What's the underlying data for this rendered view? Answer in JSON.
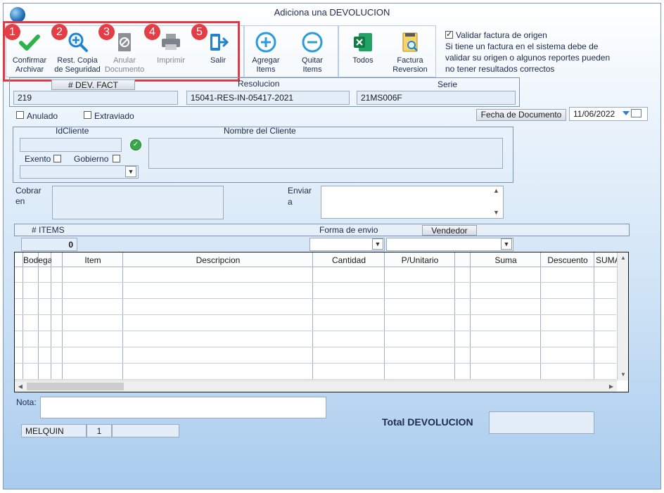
{
  "window": {
    "title": "Adiciona una DEVOLUCION"
  },
  "toolbar": {
    "confirm": {
      "badge": "1",
      "line1": "Confirmar",
      "line2": "Archivar"
    },
    "backup": {
      "badge": "2",
      "line1": "Rest. Copia",
      "line2": "de Seguridad"
    },
    "cancel": {
      "badge": "3",
      "line1": "Anular",
      "line2": "Documento"
    },
    "print": {
      "badge": "4",
      "line1": "Imprimir"
    },
    "exit": {
      "badge": "5",
      "line1": "Salir"
    },
    "add_items": {
      "line1": "Agregar",
      "line2": "Items"
    },
    "remove_items": {
      "line1": "Quitar",
      "line2": "Items"
    },
    "all": {
      "line1": "Todos"
    },
    "invoice_reversal": {
      "line1": "Factura",
      "line2": "Reversion"
    }
  },
  "validate": {
    "label": "Validar factura de origen",
    "note1": "Si tiene un factura en el sistema debe de",
    "note2": "validar su origen o algunos reportes pueden",
    "note3": "no tener resultados correctos"
  },
  "doc": {
    "dev_fact_label": "# DEV. FACT",
    "dev_fact_value": "219",
    "resolucion_label": "Resolucion",
    "resolucion_value": "15041-RES-IN-05417-2021",
    "serie_label": "Serie",
    "serie_value": "21MS006F",
    "anulado_label": "Anulado",
    "extraviado_label": "Extraviado",
    "fecha_label": "Fecha de  Documento",
    "fecha_value": "11/06/2022"
  },
  "client": {
    "id_label": "IdCliente",
    "name_label": "Nombre del Cliente",
    "exento_label": "Exento",
    "gobierno_label": "Gobierno",
    "cobrar_label1": "Cobrar",
    "cobrar_label2": "en",
    "enviar_label1": "Enviar",
    "enviar_label2": "a"
  },
  "items_bar": {
    "items_label": "# ITEMS",
    "items_count": "0",
    "forma_envio_label": "Forma de envio",
    "vendedor_label": "Vendedor"
  },
  "grid": {
    "columns": [
      "Bodega",
      "Item",
      "Descripcion",
      "Cantidad",
      "P/Unitario",
      "Suma",
      "Descuento",
      "SUMA"
    ]
  },
  "footer": {
    "nota_label": "Nota:",
    "user": "MELQUIN",
    "user_num": "1",
    "total_label": "Total DEVOLUCION"
  },
  "colors": {
    "highlight": "#e03a45",
    "accent": "#2b8fd6"
  }
}
